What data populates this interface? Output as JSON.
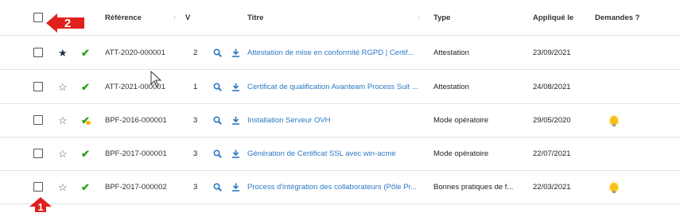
{
  "header": {
    "reference_label": "Référence",
    "sort_icon_glyph": "↑",
    "version_label": "V",
    "title_label": "Titre",
    "type_label": "Type",
    "applied_label": "Appliqué le",
    "requests_label": "Demandes ?"
  },
  "rows": [
    {
      "starred": true,
      "status": "validated",
      "reference": "ATT-2020-000001",
      "version": "2",
      "title": "Attestation de mise en conformité RGPD | Certif...",
      "type": "Attestation",
      "applied": "23/09/2021",
      "has_request": false
    },
    {
      "starred": false,
      "status": "validated",
      "reference": "ATT-2021-000001",
      "version": "1",
      "title": "Certificat de qualification Avanteam Process Suit ...",
      "type": "Attestation",
      "applied": "24/08/2021",
      "has_request": false
    },
    {
      "starred": false,
      "status": "validated-pending",
      "reference": "BPF-2016-000001",
      "version": "3",
      "title": "Installation Serveur OVH",
      "type": "Mode opératoire",
      "applied": "29/05/2020",
      "has_request": true
    },
    {
      "starred": false,
      "status": "validated",
      "reference": "BPF-2017-000001",
      "version": "3",
      "title": "Génération de Certificat SSL avec win-acme",
      "type": "Mode opératoire",
      "applied": "22/07/2021",
      "has_request": false
    },
    {
      "starred": false,
      "status": "validated",
      "reference": "BPF-2017-000002",
      "version": "3",
      "title": "Process d'intégration des collaborateurs (Pôle Pr...",
      "type": "Bonnes pratiques de f...",
      "applied": "22/03/2021",
      "has_request": true
    }
  ],
  "annotations": [
    {
      "label": "2",
      "color": "#e0201c"
    },
    {
      "label": "1",
      "color": "#e0201c"
    }
  ],
  "icons": {
    "star_filled": "★",
    "star_empty": "☆",
    "check": "✔"
  },
  "colors": {
    "link": "#2b78c5",
    "check": "#2ea01f",
    "star": "#1f3350",
    "bulb": "#f6c21a"
  }
}
